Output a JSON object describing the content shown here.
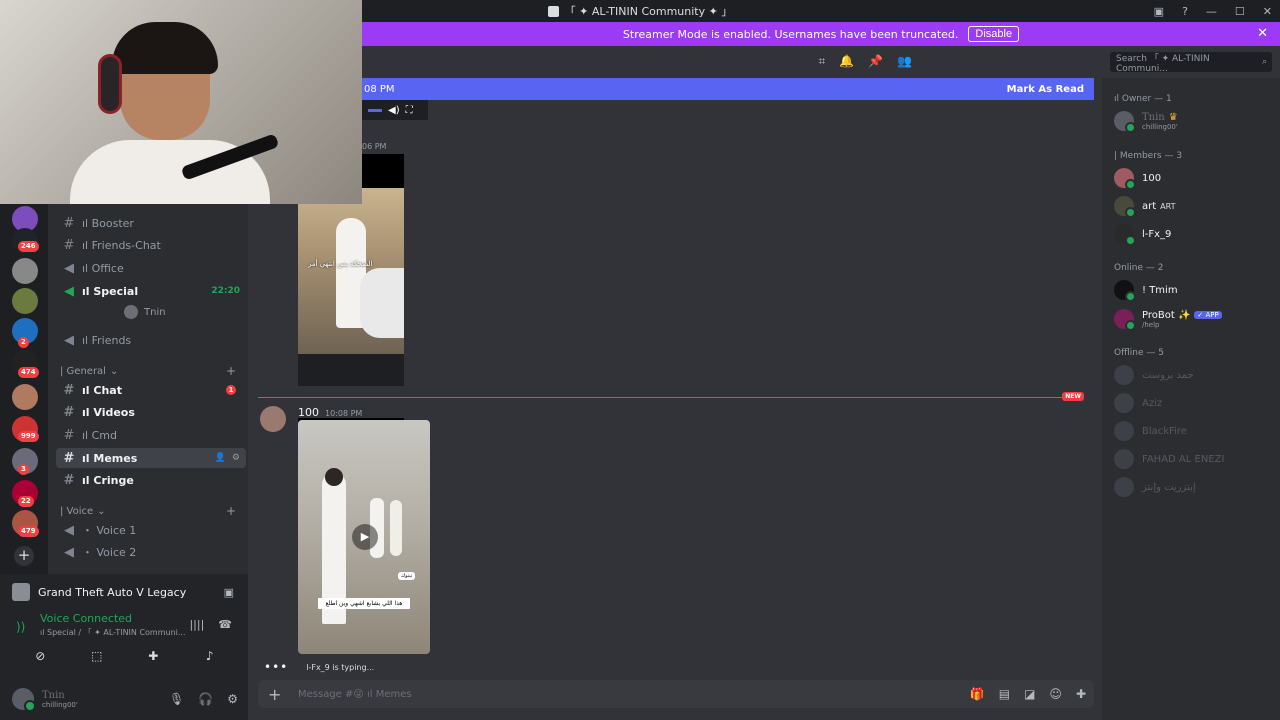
{
  "window": {
    "title": "「 ✦ AL-TININ Community ✦ 」"
  },
  "banner": {
    "text": "Streamer Mode is enabled. Usernames have been truncated.",
    "disable_label": "Disable"
  },
  "server_rail": {
    "badges": [
      "246",
      "2",
      "474",
      "999",
      "3",
      "22",
      "479"
    ]
  },
  "channels": {
    "top": [
      {
        "label": "ıl Booster",
        "icon": "hash"
      },
      {
        "label": "ıl Friends-Chat",
        "icon": "hash"
      },
      {
        "label": "ıl Office",
        "icon": "speaker"
      },
      {
        "label": "ıl Special",
        "icon": "speaker",
        "time": "22:20"
      },
      {
        "label": "ıl Friends",
        "icon": "speaker"
      }
    ],
    "voice_user": "Tnin",
    "general_category": "| General",
    "general": [
      {
        "label": "ıl Chat",
        "unread": "1"
      },
      {
        "label": "ıl Videos"
      },
      {
        "label": "ıl Cmd"
      },
      {
        "label": "ıl Memes"
      },
      {
        "label": "ıl Cringe"
      }
    ],
    "voice_category": "| Voice",
    "voice": [
      {
        "label": "・ Voice 1"
      },
      {
        "label": "・ Voice 2"
      }
    ]
  },
  "activity": {
    "game": "Grand Theft Auto V Legacy"
  },
  "voice_connection": {
    "status": "Voice Connected",
    "location": "ıl Special / 「 ✦ AL-TININ Communi..."
  },
  "user": {
    "name": "Tnin",
    "status": "chilling00'"
  },
  "chat": {
    "new_bar_time": "08 PM",
    "mark_as_read": "Mark As Read",
    "tiny_time": "06 PM",
    "video1_caption": "الضحكة بس انتهي أمر",
    "new_label": "NEW",
    "message": {
      "author": "100",
      "time": "10:08 PM",
      "caption": "هذا اللي يشابع اشهي وين اطلع",
      "tag": "تيتوك"
    },
    "typing": "l-Fx_9 is typing...",
    "composer_placeholder": "Message #😜 ıl Memes"
  },
  "search": {
    "placeholder": "Search 「 ✦ AL-TININ Communi..."
  },
  "members": {
    "owner_header": "ıl Owner — 1",
    "owner": {
      "name": "Tnin",
      "status": "chilling00'"
    },
    "members_header": "| Members — 3",
    "members": [
      {
        "name": "100"
      },
      {
        "name": "art",
        "badge": "ART"
      },
      {
        "name": "l-Fx_9"
      }
    ],
    "online_header": "Online — 2",
    "online": [
      {
        "name": "! Tmim"
      },
      {
        "name": "ProBot ✨",
        "badge": "✓ APP",
        "sub": "/help"
      }
    ],
    "offline_header": "Offline — 5",
    "offline": [
      {
        "name": "حمد بروست"
      },
      {
        "name": "Aziz"
      },
      {
        "name": "BlackFire"
      },
      {
        "name": "FAHAD AL ENEZI"
      },
      {
        "name": "إبتزريت وإبتز"
      }
    ]
  }
}
